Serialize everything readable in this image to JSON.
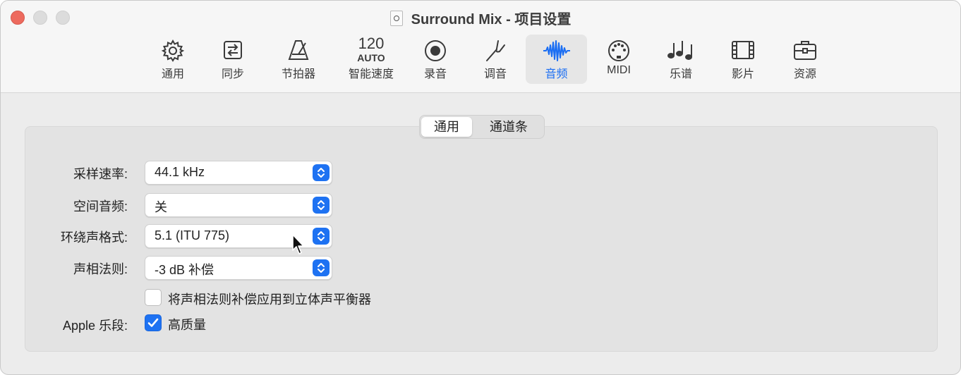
{
  "window": {
    "title": "Surround Mix - 项目设置"
  },
  "toolbar": {
    "items": [
      {
        "label": "通用",
        "icon": "gear-icon"
      },
      {
        "label": "同步",
        "icon": "sync-icon"
      },
      {
        "label": "节拍器",
        "icon": "metronome-icon"
      },
      {
        "label": "智能速度",
        "icon": "smart-tempo-icon",
        "tempo_value": "120",
        "tempo_mode": "AUTO"
      },
      {
        "label": "录音",
        "icon": "record-icon"
      },
      {
        "label": "调音",
        "icon": "tuning-fork-icon"
      },
      {
        "label": "音频",
        "icon": "waveform-icon",
        "selected": true
      },
      {
        "label": "MIDI",
        "icon": "midi-icon"
      },
      {
        "label": "乐谱",
        "icon": "score-notes-icon"
      },
      {
        "label": "影片",
        "icon": "film-icon"
      },
      {
        "label": "资源",
        "icon": "briefcase-icon"
      }
    ]
  },
  "tabs": [
    {
      "label": "通用",
      "selected": true
    },
    {
      "label": "通道条",
      "selected": false
    }
  ],
  "settings": {
    "sample_rate": {
      "label": "采样速率:",
      "value": "44.1 kHz"
    },
    "spatial_audio": {
      "label": "空间音频:",
      "value": "关"
    },
    "surround_format": {
      "label": "环绕声格式:",
      "value": "5.1 (ITU 775)"
    },
    "pan_law": {
      "label": "声相法则:",
      "value": "-3 dB 补偿"
    },
    "pan_law_checkbox": {
      "label": "将声相法则补偿应用到立体声平衡器",
      "checked": false
    },
    "apple_loops": {
      "label": "Apple 乐段:",
      "checkbox_label": "高质量",
      "checked": true
    }
  },
  "colors": {
    "accent": "#1e72f2",
    "close": "#ed6a5e"
  }
}
